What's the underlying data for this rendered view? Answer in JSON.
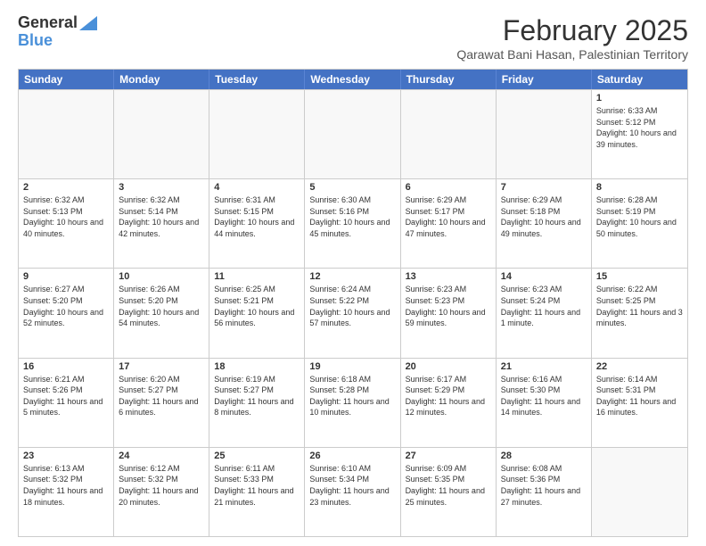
{
  "header": {
    "logo_line1": "General",
    "logo_line2": "Blue",
    "month_title": "February 2025",
    "location": "Qarawat Bani Hasan, Palestinian Territory"
  },
  "weekdays": [
    "Sunday",
    "Monday",
    "Tuesday",
    "Wednesday",
    "Thursday",
    "Friday",
    "Saturday"
  ],
  "rows": [
    [
      {
        "day": "",
        "empty": true
      },
      {
        "day": "",
        "empty": true
      },
      {
        "day": "",
        "empty": true
      },
      {
        "day": "",
        "empty": true
      },
      {
        "day": "",
        "empty": true
      },
      {
        "day": "",
        "empty": true
      },
      {
        "day": "1",
        "text": "Sunrise: 6:33 AM\nSunset: 5:12 PM\nDaylight: 10 hours and 39 minutes."
      }
    ],
    [
      {
        "day": "2",
        "text": "Sunrise: 6:32 AM\nSunset: 5:13 PM\nDaylight: 10 hours and 40 minutes."
      },
      {
        "day": "3",
        "text": "Sunrise: 6:32 AM\nSunset: 5:14 PM\nDaylight: 10 hours and 42 minutes."
      },
      {
        "day": "4",
        "text": "Sunrise: 6:31 AM\nSunset: 5:15 PM\nDaylight: 10 hours and 44 minutes."
      },
      {
        "day": "5",
        "text": "Sunrise: 6:30 AM\nSunset: 5:16 PM\nDaylight: 10 hours and 45 minutes."
      },
      {
        "day": "6",
        "text": "Sunrise: 6:29 AM\nSunset: 5:17 PM\nDaylight: 10 hours and 47 minutes."
      },
      {
        "day": "7",
        "text": "Sunrise: 6:29 AM\nSunset: 5:18 PM\nDaylight: 10 hours and 49 minutes."
      },
      {
        "day": "8",
        "text": "Sunrise: 6:28 AM\nSunset: 5:19 PM\nDaylight: 10 hours and 50 minutes."
      }
    ],
    [
      {
        "day": "9",
        "text": "Sunrise: 6:27 AM\nSunset: 5:20 PM\nDaylight: 10 hours and 52 minutes."
      },
      {
        "day": "10",
        "text": "Sunrise: 6:26 AM\nSunset: 5:20 PM\nDaylight: 10 hours and 54 minutes."
      },
      {
        "day": "11",
        "text": "Sunrise: 6:25 AM\nSunset: 5:21 PM\nDaylight: 10 hours and 56 minutes."
      },
      {
        "day": "12",
        "text": "Sunrise: 6:24 AM\nSunset: 5:22 PM\nDaylight: 10 hours and 57 minutes."
      },
      {
        "day": "13",
        "text": "Sunrise: 6:23 AM\nSunset: 5:23 PM\nDaylight: 10 hours and 59 minutes."
      },
      {
        "day": "14",
        "text": "Sunrise: 6:23 AM\nSunset: 5:24 PM\nDaylight: 11 hours and 1 minute."
      },
      {
        "day": "15",
        "text": "Sunrise: 6:22 AM\nSunset: 5:25 PM\nDaylight: 11 hours and 3 minutes."
      }
    ],
    [
      {
        "day": "16",
        "text": "Sunrise: 6:21 AM\nSunset: 5:26 PM\nDaylight: 11 hours and 5 minutes."
      },
      {
        "day": "17",
        "text": "Sunrise: 6:20 AM\nSunset: 5:27 PM\nDaylight: 11 hours and 6 minutes."
      },
      {
        "day": "18",
        "text": "Sunrise: 6:19 AM\nSunset: 5:27 PM\nDaylight: 11 hours and 8 minutes."
      },
      {
        "day": "19",
        "text": "Sunrise: 6:18 AM\nSunset: 5:28 PM\nDaylight: 11 hours and 10 minutes."
      },
      {
        "day": "20",
        "text": "Sunrise: 6:17 AM\nSunset: 5:29 PM\nDaylight: 11 hours and 12 minutes."
      },
      {
        "day": "21",
        "text": "Sunrise: 6:16 AM\nSunset: 5:30 PM\nDaylight: 11 hours and 14 minutes."
      },
      {
        "day": "22",
        "text": "Sunrise: 6:14 AM\nSunset: 5:31 PM\nDaylight: 11 hours and 16 minutes."
      }
    ],
    [
      {
        "day": "23",
        "text": "Sunrise: 6:13 AM\nSunset: 5:32 PM\nDaylight: 11 hours and 18 minutes."
      },
      {
        "day": "24",
        "text": "Sunrise: 6:12 AM\nSunset: 5:32 PM\nDaylight: 11 hours and 20 minutes."
      },
      {
        "day": "25",
        "text": "Sunrise: 6:11 AM\nSunset: 5:33 PM\nDaylight: 11 hours and 21 minutes."
      },
      {
        "day": "26",
        "text": "Sunrise: 6:10 AM\nSunset: 5:34 PM\nDaylight: 11 hours and 23 minutes."
      },
      {
        "day": "27",
        "text": "Sunrise: 6:09 AM\nSunset: 5:35 PM\nDaylight: 11 hours and 25 minutes."
      },
      {
        "day": "28",
        "text": "Sunrise: 6:08 AM\nSunset: 5:36 PM\nDaylight: 11 hours and 27 minutes."
      },
      {
        "day": "",
        "empty": true
      }
    ]
  ]
}
